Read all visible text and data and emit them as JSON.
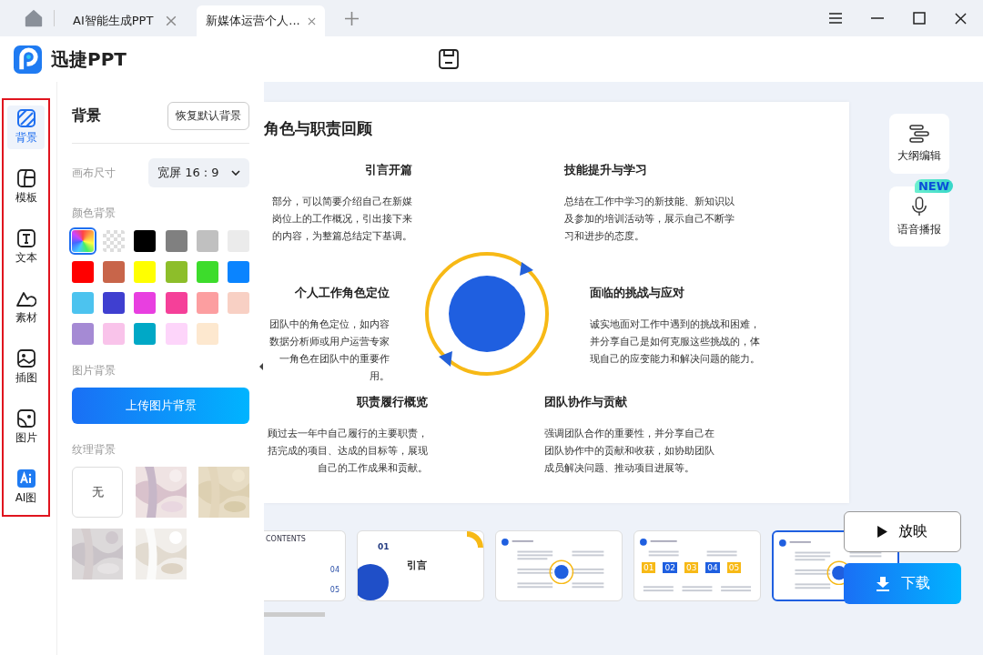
{
  "tabs": [
    {
      "label": "AI智能生成PPT",
      "selected": false
    },
    {
      "label": "新媒体运营个人...",
      "selected": true
    }
  ],
  "app": {
    "logo": "迅捷PPT"
  },
  "rail": [
    {
      "label": "背景",
      "selected": true
    },
    {
      "label": "模板",
      "selected": false
    },
    {
      "label": "文本",
      "selected": false
    },
    {
      "label": "素材",
      "selected": false
    },
    {
      "label": "插图",
      "selected": false
    },
    {
      "label": "图片",
      "selected": false
    },
    {
      "label": "AI图",
      "selected": false
    }
  ],
  "panel": {
    "title": "背景",
    "reset_button": "恢复默认背景",
    "canvas_label": "画布尺寸",
    "canvas_value": "宽屏 16 : 9",
    "color_label": "颜色背景",
    "swatches": [
      {
        "kind": "gradient",
        "selected": true
      },
      {
        "kind": "transparent",
        "selected": false
      },
      {
        "kind": "solid",
        "color": "#000000",
        "selected": false
      },
      {
        "kind": "solid",
        "color": "#808080",
        "selected": false
      },
      {
        "kind": "solid",
        "color": "#c0c0c0",
        "selected": false
      },
      {
        "kind": "solid",
        "color": "#ebebeb",
        "selected": false
      },
      {
        "kind": "solid",
        "color": "#ff0000",
        "selected": false
      },
      {
        "kind": "solid",
        "color": "#c8654a",
        "selected": false
      },
      {
        "kind": "solid",
        "color": "#ffff00",
        "selected": false
      },
      {
        "kind": "solid",
        "color": "#8dbe2a",
        "selected": false
      },
      {
        "kind": "solid",
        "color": "#3ddc2c",
        "selected": false
      },
      {
        "kind": "solid",
        "color": "#0a84ff",
        "selected": false
      },
      {
        "kind": "solid",
        "color": "#4cc3ef",
        "selected": false
      },
      {
        "kind": "solid",
        "color": "#3f3fd0",
        "selected": false
      },
      {
        "kind": "solid",
        "color": "#e83fe0",
        "selected": false
      },
      {
        "kind": "solid",
        "color": "#f54099",
        "selected": false
      },
      {
        "kind": "solid",
        "color": "#fc9ea0",
        "selected": false
      },
      {
        "kind": "solid",
        "color": "#f8d0c4",
        "selected": false
      },
      {
        "kind": "solid",
        "color": "#a58ad4",
        "selected": false
      },
      {
        "kind": "solid",
        "color": "#f9c3ea",
        "selected": false
      },
      {
        "kind": "solid",
        "color": "#00a8c6",
        "selected": false
      },
      {
        "kind": "solid",
        "color": "#fdd5fa",
        "selected": false
      },
      {
        "kind": "solid",
        "color": "#fde8cf",
        "selected": false
      }
    ],
    "image_label": "图片背景",
    "upload_button": "上传图片背景",
    "texture_label": "纹理背景",
    "textures": [
      {
        "kind": "none",
        "label": "无"
      },
      {
        "kind": "picture"
      },
      {
        "kind": "picture"
      },
      {
        "kind": "picture"
      },
      {
        "kind": "picture"
      }
    ]
  },
  "slide": {
    "title": "角色与职责回顾",
    "sections": [
      {
        "title": "引言开篇",
        "lines": [
          "部分，可以简要介绍自己在新媒",
          "岗位上的工作概况，引出接下来",
          "的内容，为整篇总结定下基调。"
        ]
      },
      {
        "title": "技能提升与学习",
        "lines": [
          "总结在工作中学习的新技能、新知识以",
          "及参加的培训活动等，展示自己不断学",
          "习和进步的态度。"
        ]
      },
      {
        "title": "个人工作角色定位",
        "lines": [
          "团队中的角色定位，如内容",
          "数据分析师或用户运营专家",
          "一角色在团队中的重要作",
          "用。"
        ]
      },
      {
        "title": "面临的挑战与应对",
        "lines": [
          "诚实地面对工作中遇到的挑战和困难，",
          "并分享自己是如何克服这些挑战的，体",
          "现自己的应变能力和解决问题的能力。"
        ]
      },
      {
        "title": "职责履行概览",
        "lines": [
          "顾过去一年中自己履行的主要职责，",
          "括完成的项目、达成的目标等，展现",
          "自己的工作成果和贡献。"
        ]
      },
      {
        "title": "团队协作与贡献",
        "lines": [
          "强调团队合作的重要性，并分享自己在",
          "团队协作中的贡献和收获，如协助团队",
          "成员解决问题、推动项目进展等。"
        ]
      }
    ]
  },
  "tools": [
    {
      "label": "大纲编辑"
    },
    {
      "label": "语音播报",
      "badge": "NEW"
    }
  ],
  "thumbnails": [
    {
      "kind": "contents",
      "texts": [
        "CONTENTS",
        "04",
        "05"
      ],
      "selected": false
    },
    {
      "kind": "section",
      "texts": [
        "01",
        "引言"
      ],
      "selected": false
    },
    {
      "kind": "circle",
      "selected": false
    },
    {
      "kind": "steps",
      "texts": [
        "01",
        "02",
        "03",
        "04",
        "05"
      ],
      "selected": false
    },
    {
      "kind": "circle",
      "selected": true
    }
  ],
  "actions": {
    "play": "放映",
    "download": "下载"
  }
}
